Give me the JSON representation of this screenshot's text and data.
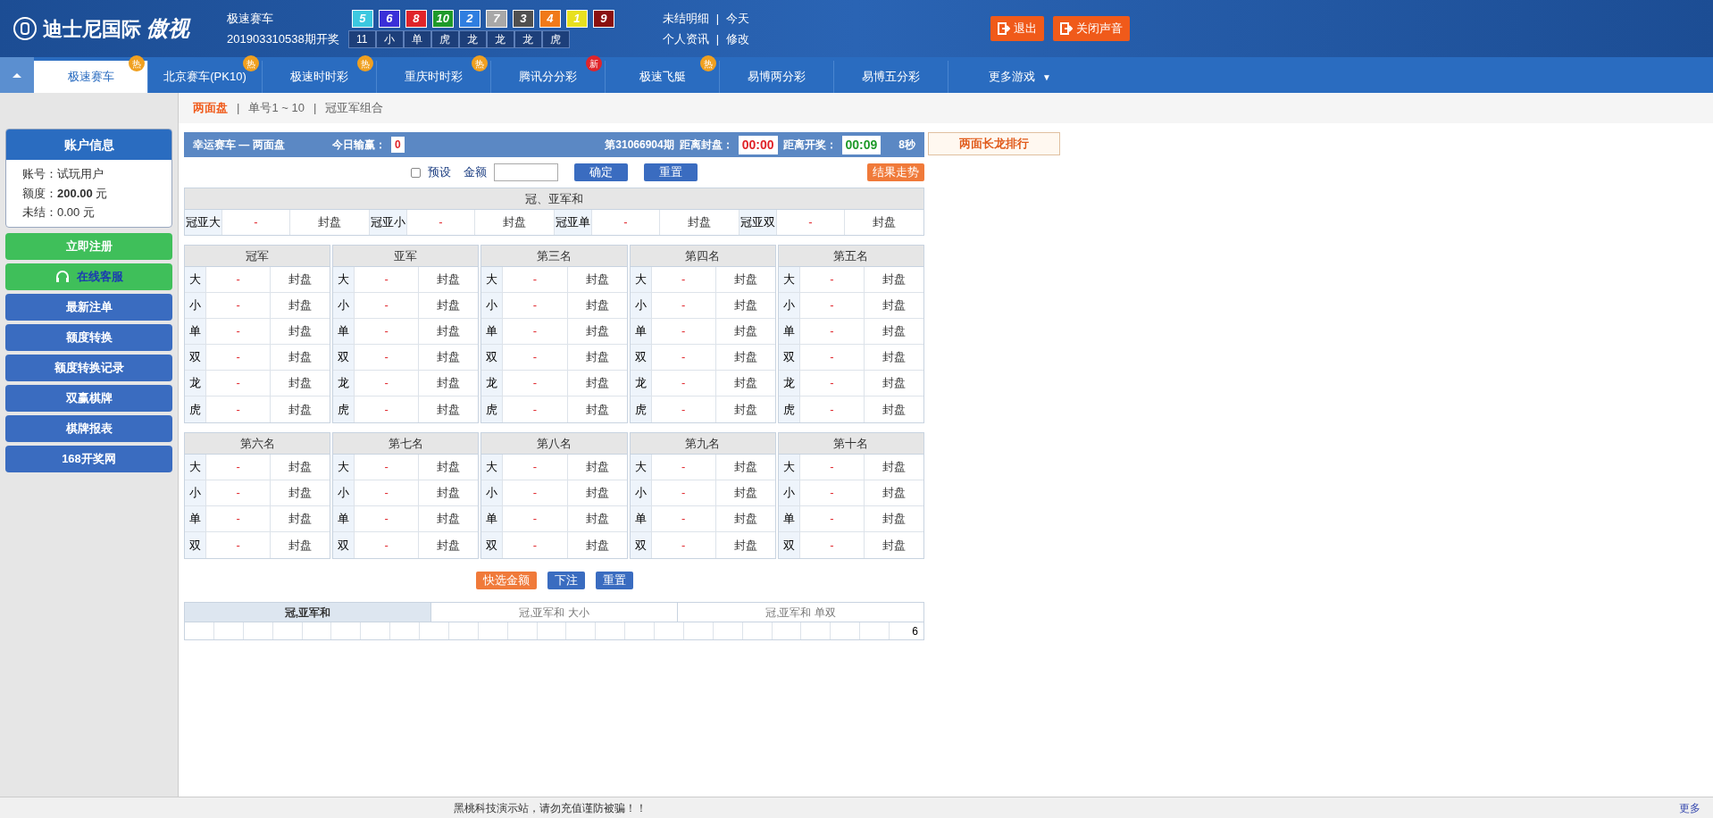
{
  "header": {
    "logo_text": "迪士尼国际",
    "logo_script": "傲视",
    "game": "极速赛车",
    "draw": "201903310538期开奖",
    "balls": [
      {
        "number": "5",
        "color": "#3cc8e0"
      },
      {
        "number": "6",
        "color": "#3a2fd8"
      },
      {
        "number": "8",
        "color": "#e0242a"
      },
      {
        "number": "10",
        "color": "#1f9a2a"
      },
      {
        "number": "2",
        "color": "#2f7ee0"
      },
      {
        "number": "7",
        "color": "#a8a8a8"
      },
      {
        "number": "3",
        "color": "#505050"
      },
      {
        "number": "4",
        "color": "#f07a1a"
      },
      {
        "number": "1",
        "color": "#e8e020"
      },
      {
        "number": "9",
        "color": "#8a1010"
      }
    ],
    "results": [
      "11",
      "小",
      "单",
      "虎",
      "龙",
      "龙",
      "龙",
      "虎"
    ],
    "links": [
      [
        "未结明细",
        "|",
        "今天"
      ],
      [
        "个人资讯",
        "|",
        "修改"
      ]
    ],
    "buttons": [
      "退出",
      "关闭声音"
    ]
  },
  "nav": {
    "tabs": [
      {
        "label": "极速赛车",
        "selected": true,
        "badge": "热"
      },
      {
        "label": "北京赛车(PK10)",
        "selected": false,
        "badge": "热"
      },
      {
        "label": "极速时时彩",
        "selected": false,
        "badge": "热"
      },
      {
        "label": "重庆时时彩",
        "selected": false,
        "badge": "热"
      },
      {
        "label": "腾讯分分彩",
        "selected": false,
        "badge": "新"
      },
      {
        "label": "极速飞艇",
        "selected": false,
        "badge": "热"
      },
      {
        "label": "易博两分彩",
        "selected": false
      },
      {
        "label": "易博五分彩",
        "selected": false
      }
    ],
    "more": "更多游戏",
    "more_arrow": "▼"
  },
  "subnav": [
    {
      "label": "两面盘",
      "selected": true
    },
    {
      "label": "单号1 ~ 10",
      "selected": false
    },
    {
      "label": "冠亚军组合",
      "selected": false
    }
  ],
  "subnav_separators": [
    "|",
    "|"
  ],
  "sidebar": {
    "title": "账户信息",
    "rows": [
      {
        "label": "账号：",
        "value": "试玩用户"
      },
      {
        "label": "额度：",
        "value": "200.00",
        "unit": "元"
      },
      {
        "label": "未结：",
        "value": "0.00",
        "unit": "元"
      }
    ],
    "buttons": [
      {
        "label": "立即注册",
        "kind": "green"
      },
      {
        "label": "在线客服",
        "kind": "support"
      },
      {
        "label": "最新注单",
        "kind": "blue"
      },
      {
        "label": "额度转换",
        "kind": "blue"
      },
      {
        "label": "额度转换记录",
        "kind": "blue"
      },
      {
        "label": "双赢棋牌",
        "kind": "blue"
      },
      {
        "label": "棋牌报表",
        "kind": "blue"
      },
      {
        "label": "168开奖网",
        "kind": "blue"
      }
    ]
  },
  "panel": {
    "title": "幸运赛车 — 两面盘",
    "today_label": "今日输赢：",
    "today_value": "0",
    "period": "第31066904期",
    "close_label": "距离封盘：",
    "close_time": "00:00",
    "open_label": "距离开奖：",
    "open_time": "00:09",
    "seconds": "8秒",
    "side_button": "两面长龙排行"
  },
  "form": {
    "preset_label": "预设",
    "preset_checked": false,
    "amount_label": "金额",
    "confirm": "确定",
    "reset": "重置",
    "trend": "结果走势"
  },
  "sum_table": {
    "title": "冠、亚军和",
    "cells": [
      {
        "name": "冠亚大",
        "odds": "-",
        "status": "封盘"
      },
      {
        "name": "冠亚小",
        "odds": "-",
        "status": "封盘"
      },
      {
        "name": "冠亚单",
        "odds": "-",
        "status": "封盘"
      },
      {
        "name": "冠亚双",
        "odds": "-",
        "status": "封盘"
      }
    ]
  },
  "positions": [
    {
      "title": "冠军",
      "rows": [
        [
          "大",
          "-",
          "封盘"
        ],
        [
          "小",
          "-",
          "封盘"
        ],
        [
          "单",
          "-",
          "封盘"
        ],
        [
          "双",
          "-",
          "封盘"
        ],
        [
          "龙",
          "-",
          "封盘"
        ],
        [
          "虎",
          "-",
          "封盘"
        ]
      ]
    },
    {
      "title": "亚军",
      "rows": [
        [
          "大",
          "-",
          "封盘"
        ],
        [
          "小",
          "-",
          "封盘"
        ],
        [
          "单",
          "-",
          "封盘"
        ],
        [
          "双",
          "-",
          "封盘"
        ],
        [
          "龙",
          "-",
          "封盘"
        ],
        [
          "虎",
          "-",
          "封盘"
        ]
      ]
    },
    {
      "title": "第三名",
      "rows": [
        [
          "大",
          "-",
          "封盘"
        ],
        [
          "小",
          "-",
          "封盘"
        ],
        [
          "单",
          "-",
          "封盘"
        ],
        [
          "双",
          "-",
          "封盘"
        ],
        [
          "龙",
          "-",
          "封盘"
        ],
        [
          "虎",
          "-",
          "封盘"
        ]
      ]
    },
    {
      "title": "第四名",
      "rows": [
        [
          "大",
          "-",
          "封盘"
        ],
        [
          "小",
          "-",
          "封盘"
        ],
        [
          "单",
          "-",
          "封盘"
        ],
        [
          "双",
          "-",
          "封盘"
        ],
        [
          "龙",
          "-",
          "封盘"
        ],
        [
          "虎",
          "-",
          "封盘"
        ]
      ]
    },
    {
      "title": "第五名",
      "rows": [
        [
          "大",
          "-",
          "封盘"
        ],
        [
          "小",
          "-",
          "封盘"
        ],
        [
          "单",
          "-",
          "封盘"
        ],
        [
          "双",
          "-",
          "封盘"
        ],
        [
          "龙",
          "-",
          "封盘"
        ],
        [
          "虎",
          "-",
          "封盘"
        ]
      ]
    },
    {
      "title": "第六名",
      "rows": [
        [
          "大",
          "-",
          "封盘"
        ],
        [
          "小",
          "-",
          "封盘"
        ],
        [
          "单",
          "-",
          "封盘"
        ],
        [
          "双",
          "-",
          "封盘"
        ]
      ]
    },
    {
      "title": "第七名",
      "rows": [
        [
          "大",
          "-",
          "封盘"
        ],
        [
          "小",
          "-",
          "封盘"
        ],
        [
          "单",
          "-",
          "封盘"
        ],
        [
          "双",
          "-",
          "封盘"
        ]
      ]
    },
    {
      "title": "第八名",
      "rows": [
        [
          "大",
          "-",
          "封盘"
        ],
        [
          "小",
          "-",
          "封盘"
        ],
        [
          "单",
          "-",
          "封盘"
        ],
        [
          "双",
          "-",
          "封盘"
        ]
      ]
    },
    {
      "title": "第九名",
      "rows": [
        [
          "大",
          "-",
          "封盘"
        ],
        [
          "小",
          "-",
          "封盘"
        ],
        [
          "单",
          "-",
          "封盘"
        ],
        [
          "双",
          "-",
          "封盘"
        ]
      ]
    },
    {
      "title": "第十名",
      "rows": [
        [
          "大",
          "-",
          "封盘"
        ],
        [
          "小",
          "-",
          "封盘"
        ],
        [
          "单",
          "-",
          "封盘"
        ],
        [
          "双",
          "-",
          "封盘"
        ]
      ]
    }
  ],
  "actions": [
    {
      "label": "快选金额",
      "kind": "orange"
    },
    {
      "label": "下注",
      "kind": "blue"
    },
    {
      "label": "重置",
      "kind": "blue"
    }
  ],
  "road": {
    "tabs": [
      {
        "label": "冠,亚军和",
        "selected": true
      },
      {
        "label": "冠,亚军和 大小",
        "selected": false
      },
      {
        "label": "冠,亚军和 单双",
        "selected": false
      }
    ],
    "last_cell": "6"
  },
  "footer": {
    "notice": "黑桃科技演示站，请勿充值谨防被骗！！",
    "more": "更多"
  }
}
